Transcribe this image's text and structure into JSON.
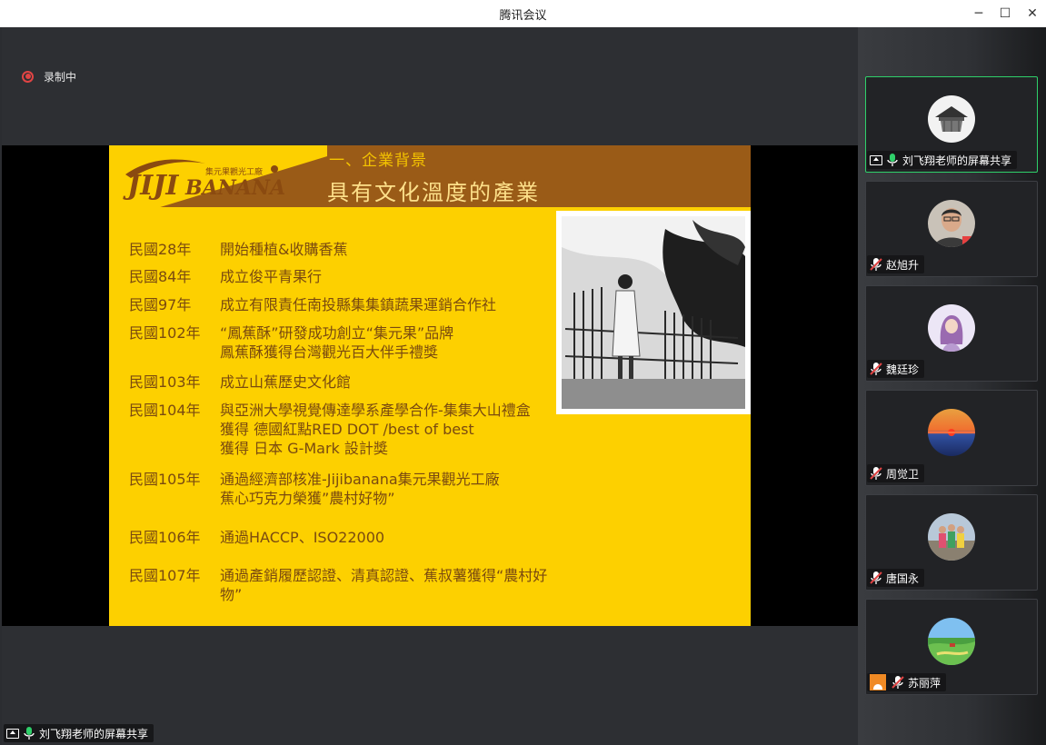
{
  "window": {
    "title": "腾讯会议",
    "minimize_glyph": "─",
    "maximize_glyph": "☐",
    "close_glyph": "✕"
  },
  "recording": {
    "label": "录制中",
    "icon": "record-icon",
    "color": "#e04444"
  },
  "slide": {
    "logo_text": "JIJI BANANA",
    "logo_subtext": "集元果觀光工廠",
    "section_label": "一、企業背景",
    "title": "具有文化溫度的產業",
    "colors": {
      "background": "#fdd000",
      "header": "#9a5b17",
      "text": "#7a4a10"
    },
    "timeline": [
      {
        "year": "民國28年",
        "lines": [
          "開始種植&收購香蕉"
        ]
      },
      {
        "year": "民國84年",
        "lines": [
          "成立俊平青果行"
        ]
      },
      {
        "year": "民國97年",
        "lines": [
          "成立有限責任南投縣集集鎮蔬果運銷合作社"
        ]
      },
      {
        "year": "民國102年",
        "lines": [
          "“鳳蕉酥”研發成功創立“集元果”品牌",
          "鳳蕉酥獲得台灣觀光百大伴手禮獎"
        ]
      },
      {
        "year": "民國103年",
        "lines": [
          "成立山蕉歷史文化館"
        ]
      },
      {
        "year": "民國104年",
        "lines": [
          "與亞洲大學視覺傳達學系產學合作-集集大山禮盒",
          "獲得 德國紅點RED DOT /best of best",
          "獲得 日本 G-Mark 設計獎"
        ]
      },
      {
        "year": "民國105年",
        "lines": [
          "通過經濟部核准-Jijibanana集元果觀光工廠",
          "蕉心巧克力榮獲”農村好物”"
        ]
      },
      {
        "year": "民國106年",
        "lines": [
          "通過HACCP、ISO22000"
        ]
      },
      {
        "year": "民國107年",
        "lines": [
          "通過產銷履歷認證、清真認證、蕉叔薯獲得“農村好",
          "物”"
        ]
      }
    ]
  },
  "share_tag": {
    "label": "刘飞翔老师的屏幕共享",
    "icon": "screen-share-icon"
  },
  "participants": [
    {
      "name": "刘飞翔老师的屏幕共享",
      "icon": "screen-share-icon",
      "mic": "mic-on-icon",
      "active": true,
      "avatar": "temple-sketch-avatar"
    },
    {
      "name": "赵旭升",
      "mic": "mic-muted-icon",
      "avatar": "man-portrait-avatar"
    },
    {
      "name": "魏廷珍",
      "mic": "mic-muted-icon",
      "avatar": "girl-illustration-avatar"
    },
    {
      "name": "周觉卫",
      "mic": "mic-muted-icon",
      "avatar": "sunset-avatar"
    },
    {
      "name": "唐国永",
      "mic": "mic-muted-icon",
      "avatar": "group-photo-avatar"
    },
    {
      "name": "苏丽萍",
      "mic": "mic-muted-icon",
      "avatar": "landscape-avatar",
      "self_badge": true
    }
  ],
  "accent_active": "#2fd06a"
}
